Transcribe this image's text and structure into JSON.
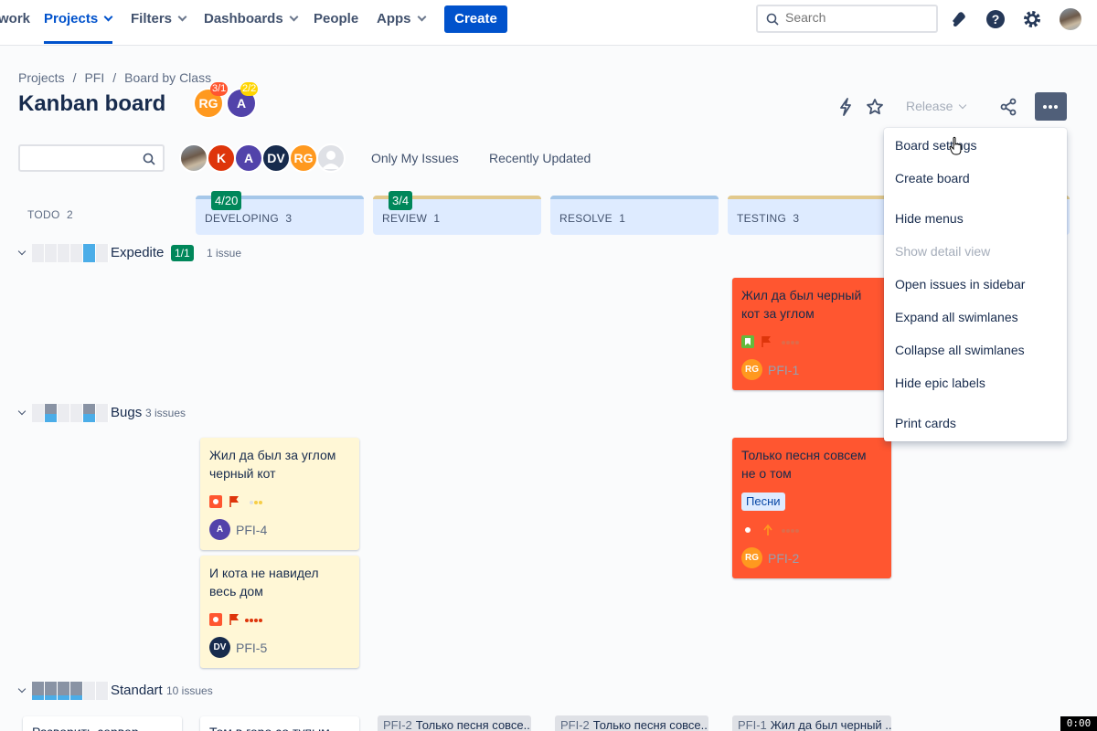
{
  "nav": {
    "cut_item": "work",
    "projects": "Projects",
    "filters": "Filters",
    "dashboards": "Dashboards",
    "people": "People",
    "apps": "Apps",
    "create": "Create",
    "search_placeholder": "Search",
    "accent": "#0052cc"
  },
  "breadcrumb": {
    "projects": "Projects",
    "project": "PFI",
    "board": "Board by Class"
  },
  "title": "Kanban board",
  "title_avatars": [
    {
      "initials": "RG",
      "color": "#ff991f",
      "badge": "3/1",
      "badge_color": "#ff5630"
    },
    {
      "initials": "A",
      "color": "#5243aa",
      "badge": "2/2",
      "badge_color": "#ffd500"
    }
  ],
  "header": {
    "release": "Release"
  },
  "filters": {
    "avatars": [
      "K",
      "A",
      "DV",
      "RG"
    ],
    "only_my_issues": "Only My Issues",
    "recently_updated": "Recently Updated"
  },
  "columns": [
    {
      "name": "TODO",
      "count": "2"
    },
    {
      "name": "DEVELOPING",
      "count": "3",
      "wip": "4/20"
    },
    {
      "name": "REVIEW",
      "count": "1",
      "wip": "3/4"
    },
    {
      "name": "RESOLVE",
      "count": "1"
    },
    {
      "name": "TESTING",
      "count": "3"
    }
  ],
  "swimlanes": {
    "expedite": {
      "name": "Expedite",
      "badge": "1/1",
      "count": "1 issue"
    },
    "bugs": {
      "name": "Bugs",
      "count": "3 issues"
    },
    "standart": {
      "name": "Standart",
      "count": "10 issues"
    }
  },
  "cards": {
    "pfi1": {
      "summary": "Жил да был черный кот за углом",
      "key": "PFI-1",
      "assignee": "RG"
    },
    "pfi4": {
      "summary": "Жил да был за углом черный кот",
      "key": "PFI-4",
      "assignee": "A"
    },
    "pfi5": {
      "summary": "И кота не навидел весь дом",
      "key": "PFI-5",
      "assignee": "DV"
    },
    "pfi2": {
      "summary": "Только песня совсем не о том",
      "key": "PFI-2",
      "assignee": "RG",
      "label": "Песни"
    }
  },
  "collapsed": [
    {
      "text": "Разворить сервер"
    },
    {
      "text": "Том в горо со тупым"
    },
    {
      "key": "PFI-2",
      "text": "Только песня совсе..."
    },
    {
      "key": "PFI-2",
      "text": "Только песня совсе..."
    },
    {
      "key": "PFI-1",
      "text": "Жил да был черный ..."
    }
  ],
  "menu": {
    "board_settings": "Board settings",
    "create_board": "Create board",
    "hide_menus": "Hide menus",
    "show_detail_view": "Show detail view",
    "open_in_sidebar": "Open issues in sidebar",
    "expand_all": "Expand all swimlanes",
    "collapse_all": "Collapse all swimlanes",
    "hide_epic_labels": "Hide epic labels",
    "print_cards": "Print cards"
  },
  "timer": "0:00"
}
